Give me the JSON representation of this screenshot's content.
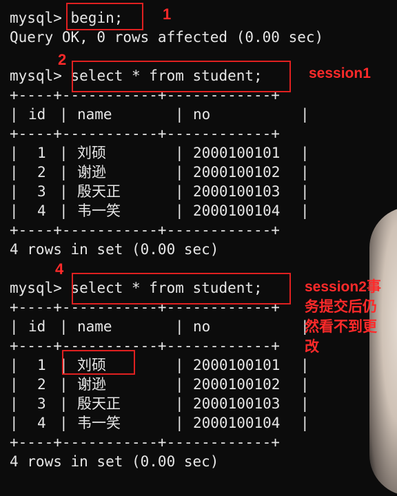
{
  "terminal": {
    "prompt": "mysql>",
    "cmd_begin": "begin;",
    "query_ok": "Query OK, 0 rows affected (0.00 sec)",
    "cmd_select": "select * from student;",
    "rows_in_set": "4 rows in set (0.00 sec)",
    "table_border": "+----+-----------+------------+",
    "columns": [
      "id",
      "name",
      "no"
    ],
    "rows": [
      [
        "1",
        "刘硕",
        "2000100101"
      ],
      [
        "2",
        "谢逊",
        "2000100102"
      ],
      [
        "3",
        "殷天正",
        "2000100103"
      ],
      [
        "4",
        "韦一笑",
        "2000100104"
      ]
    ]
  },
  "annotations": {
    "step1": "1",
    "step2": "2",
    "step4": "4",
    "session1": "session1",
    "session2_note_lines": [
      "session2事",
      "务提交后仍",
      "然看不到更",
      "改"
    ]
  },
  "colors": {
    "annotation": "#e02020",
    "text": "#e6e6e6",
    "background": "#0c0c0c"
  }
}
